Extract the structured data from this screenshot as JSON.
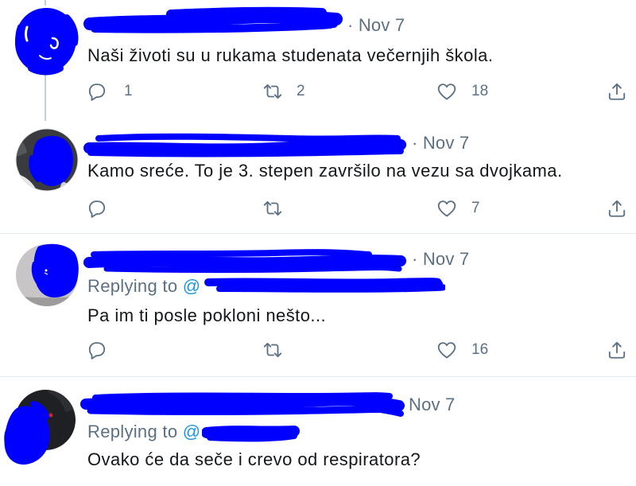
{
  "colors": {
    "background": "#ffffff",
    "text": "#14171a",
    "secondary": "#5b7083",
    "link": "#1b95e0",
    "redaction": "#0000ff",
    "divider": "#e1e8ed",
    "thread_line": "#c4cfd6"
  },
  "tweets": [
    {
      "separator": "·",
      "date": "Nov 7",
      "text": "Naši životi su u rukama studenata večernjih škola.",
      "actions": {
        "reply": {
          "icon": "reply-icon",
          "count": "1"
        },
        "retweet": {
          "icon": "retweet-icon",
          "count": "2"
        },
        "like": {
          "icon": "heart-icon",
          "count": "18"
        },
        "share": {
          "icon": "share-icon"
        }
      }
    },
    {
      "separator": "·",
      "date": "Nov 7",
      "text": "Kamo sreće. To je 3. stepen završilo na vezu sa dvojkama.",
      "actions": {
        "reply": {
          "icon": "reply-icon"
        },
        "retweet": {
          "icon": "retweet-icon"
        },
        "like": {
          "icon": "heart-icon",
          "count": "7"
        },
        "share": {
          "icon": "share-icon"
        }
      }
    },
    {
      "separator": "·",
      "date": "Nov 7",
      "replying_to": {
        "label": "Replying to",
        "handle_prefix": "@"
      },
      "text": "Pa im ti posle pokloni nešto...",
      "actions": {
        "reply": {
          "icon": "reply-icon"
        },
        "retweet": {
          "icon": "retweet-icon"
        },
        "like": {
          "icon": "heart-icon",
          "count": "16"
        },
        "share": {
          "icon": "share-icon"
        }
      }
    },
    {
      "date": "Nov 7",
      "replying_to": {
        "label": "Replying to",
        "handle_prefix": "@"
      },
      "text": "Ovako će da seče i crevo od respiratora?"
    }
  ]
}
